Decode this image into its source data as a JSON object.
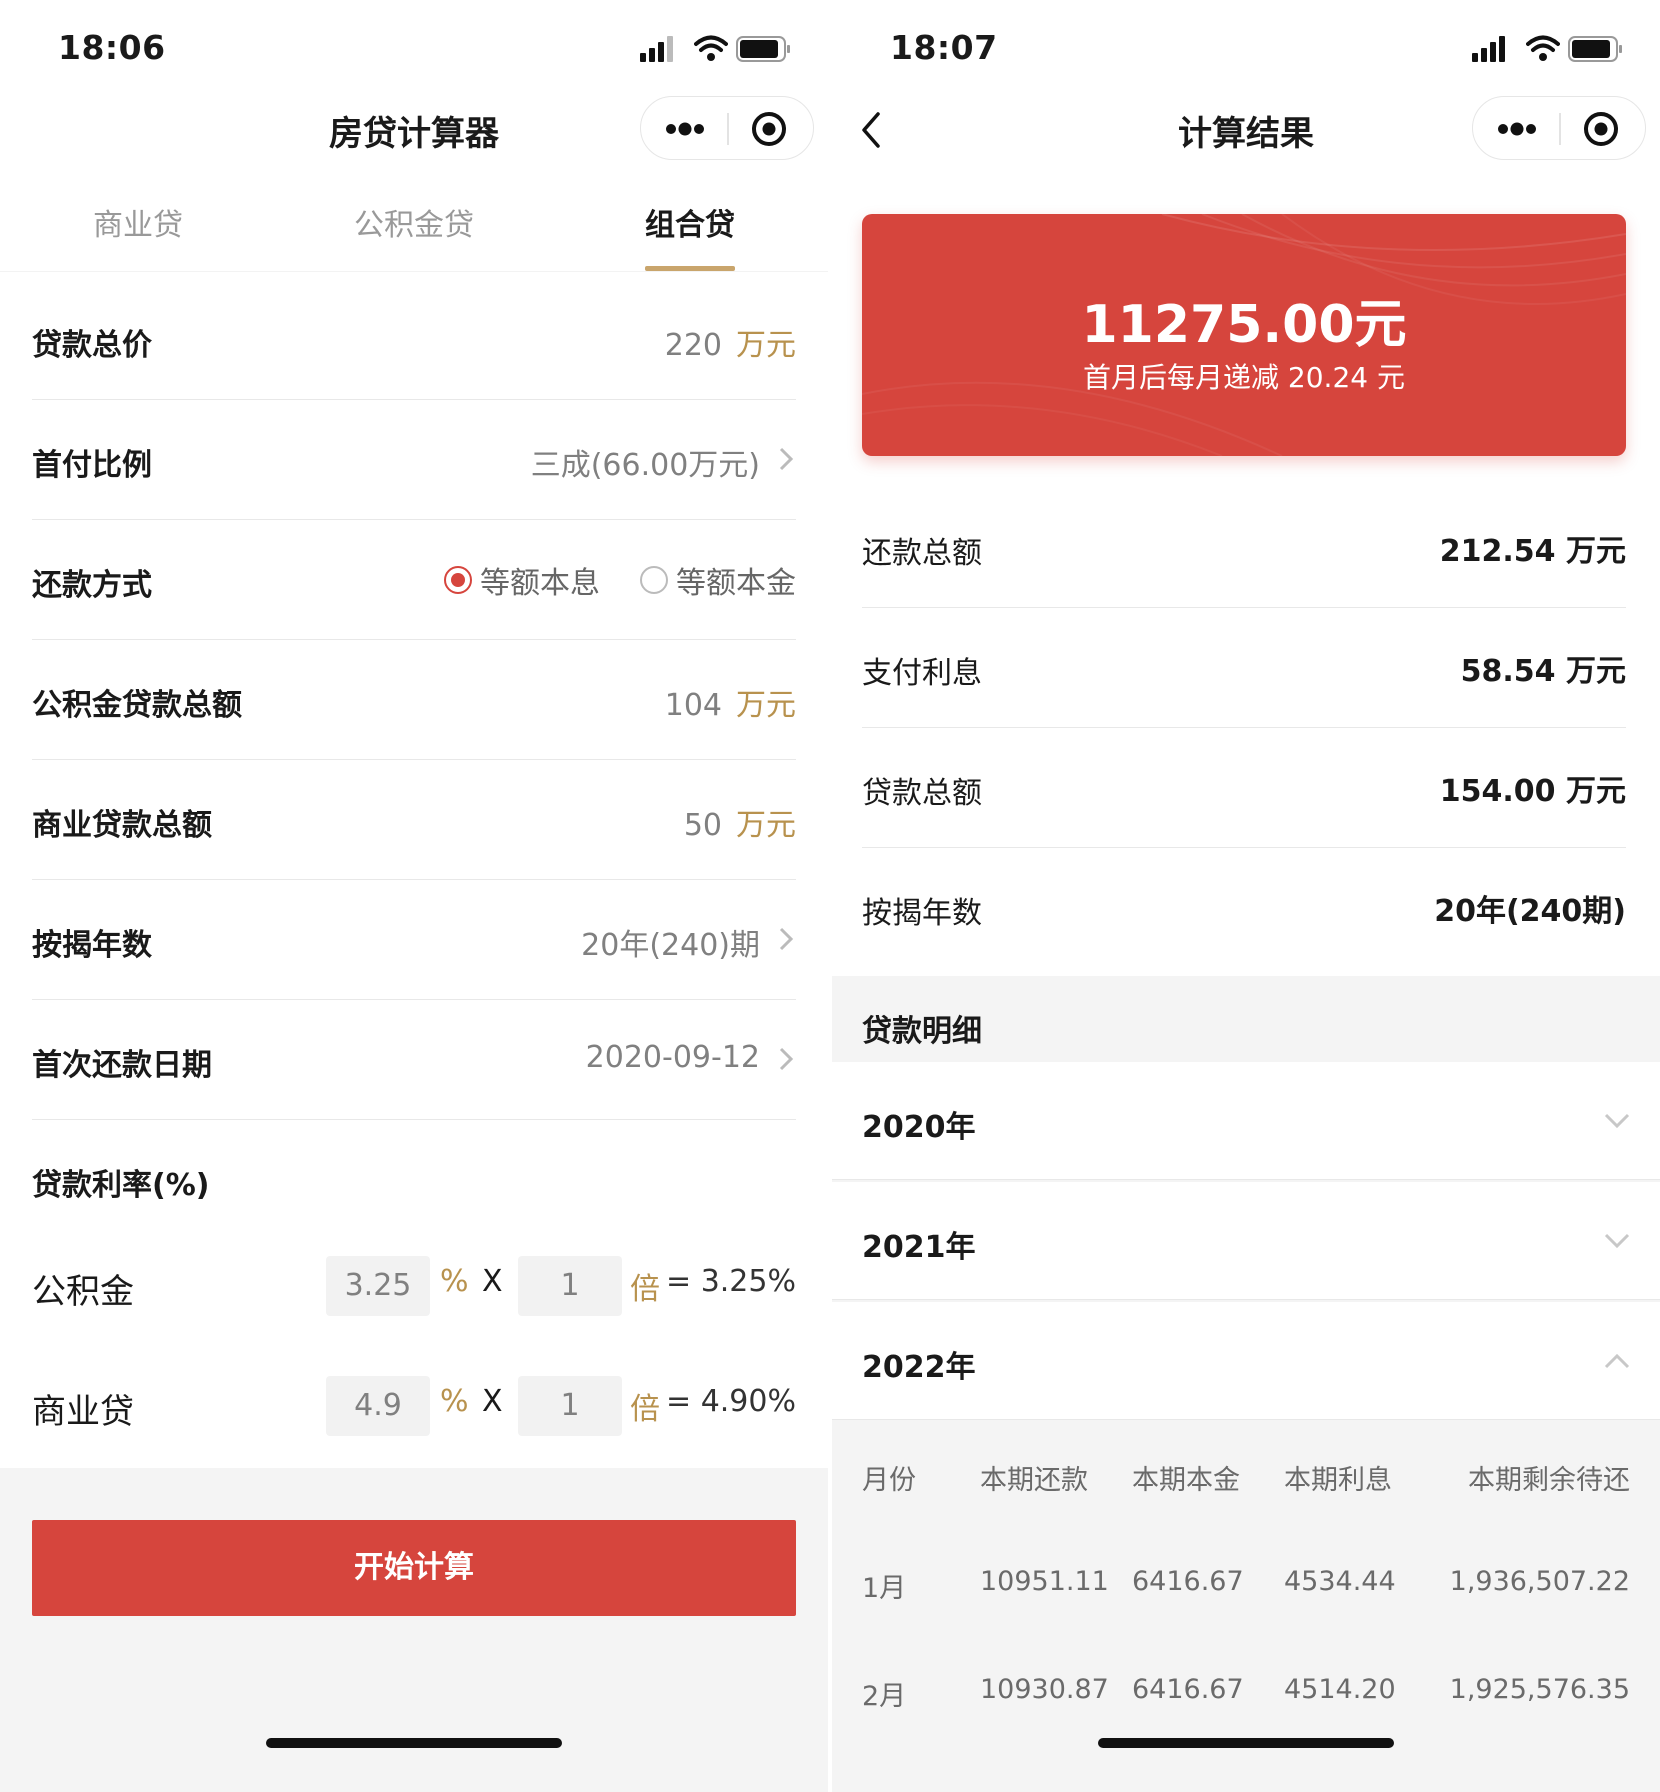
{
  "left": {
    "status_time": "18:06",
    "nav_title": "房贷计算器",
    "tabs": [
      {
        "label": "商业贷"
      },
      {
        "label": "公积金贷"
      },
      {
        "label": "组合贷"
      }
    ],
    "active_tab": 2,
    "rows": {
      "total_price": {
        "label": "贷款总价",
        "value": "220",
        "unit": "万元"
      },
      "down_payment": {
        "label": "首付比例",
        "value": "三成(66.00万元)"
      },
      "repay_method": {
        "label": "还款方式",
        "option1": "等额本息",
        "option2": "等额本金",
        "selected": "等额本息"
      },
      "fund_total": {
        "label": "公积金贷款总额",
        "value": "104",
        "unit": "万元"
      },
      "commercial_total": {
        "label": "商业贷款总额",
        "value": "50",
        "unit": "万元"
      },
      "years": {
        "label": "按揭年数",
        "value": "20年(240)期"
      },
      "first_date": {
        "label": "首次还款日期",
        "value": "2020-09-12"
      },
      "rate_header": {
        "label": "贷款利率(%)"
      }
    },
    "rates": {
      "fund": {
        "label": "公积金",
        "rate": "3.25",
        "pct": "%",
        "x": "X",
        "multiplier": "1",
        "bei": "倍",
        "result": "= 3.25%"
      },
      "commercial": {
        "label": "商业贷",
        "rate": "4.9",
        "pct": "%",
        "x": "X",
        "multiplier": "1",
        "bei": "倍",
        "result": "= 4.90%"
      }
    },
    "calc_button": "开始计算"
  },
  "right": {
    "status_time": "18:07",
    "nav_title": "计算结果",
    "card": {
      "main": "11275.00元",
      "sub": "首月后每月递减 20.24 元"
    },
    "summary": [
      {
        "label": "还款总额",
        "value": "212.54 万元"
      },
      {
        "label": "支付利息",
        "value": "58.54 万元"
      },
      {
        "label": "贷款总额",
        "value": "154.00 万元"
      },
      {
        "label": "按揭年数",
        "value": "20年(240期)"
      }
    ],
    "detail_title": "贷款明细",
    "years": [
      {
        "label": "2020年",
        "expanded": false
      },
      {
        "label": "2021年",
        "expanded": false
      },
      {
        "label": "2022年",
        "expanded": true
      }
    ],
    "table": {
      "headers": {
        "month": "月份",
        "payment": "本期还款",
        "principal": "本期本金",
        "interest": "本期利息",
        "remaining": "本期剩余待还"
      },
      "rows": [
        {
          "month": "1月",
          "payment": "10951.11",
          "principal": "6416.67",
          "interest": "4534.44",
          "remaining": "1,936,507.22"
        },
        {
          "month": "2月",
          "payment": "10930.87",
          "principal": "6416.67",
          "interest": "4514.20",
          "remaining": "1,925,576.35"
        }
      ]
    }
  },
  "colors": {
    "accent_red": "#d6453d",
    "gold": "#b8924e",
    "tab_underline": "#c9a56c"
  },
  "icons": [
    "signal-icon",
    "wifi-icon",
    "battery-icon",
    "more-icon",
    "target-icon",
    "chevron-right-icon",
    "chevron-left-icon",
    "chevron-down-icon",
    "chevron-up-icon"
  ]
}
